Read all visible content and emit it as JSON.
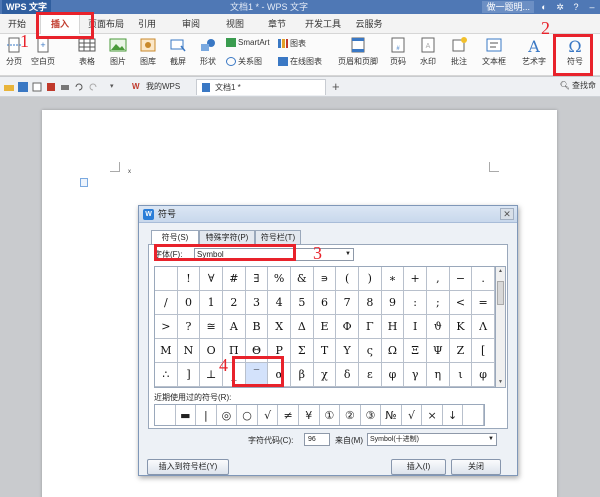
{
  "titlebar": {
    "app_name": "WPS 文字",
    "doc_title": "文档1 * - WPS 文字",
    "user_button": "做一题明...",
    "help_label": "?"
  },
  "ribbon_tabs": [
    "开始",
    "插入",
    "页面布局",
    "引用",
    "审阅",
    "视图",
    "章节",
    "开发工具",
    "云服务"
  ],
  "ribbon": {
    "buttons": [
      {
        "label": "分页",
        "icon": "page-break-icon"
      },
      {
        "label": "空白页",
        "icon": "blank-page-icon"
      },
      {
        "label": "表格",
        "icon": "table-icon"
      },
      {
        "label": "图片",
        "icon": "picture-icon"
      },
      {
        "label": "图库",
        "icon": "gallery-icon"
      },
      {
        "label": "截屏",
        "icon": "screenshot-icon"
      },
      {
        "label": "形状",
        "icon": "shapes-icon"
      },
      {
        "label": "页眉和页脚",
        "icon": "header-footer-icon"
      },
      {
        "label": "页码",
        "icon": "page-number-icon"
      },
      {
        "label": "水印",
        "icon": "watermark-icon"
      },
      {
        "label": "批注",
        "icon": "comment-icon"
      },
      {
        "label": "文本框",
        "icon": "textbox-icon"
      },
      {
        "label": "艺术字",
        "icon": "wordart-icon"
      },
      {
        "label": "符号",
        "icon": "omega-icon"
      }
    ],
    "smartart": "SmartArt",
    "chart": "图表",
    "relation": "关系图",
    "online_chart": "在线图表"
  },
  "quickbar": {
    "tab_wps": "我的WPS",
    "tab_doc": "文档1 *",
    "search": "查找命"
  },
  "dialog": {
    "title": "符号",
    "tabs": [
      "符号(S)",
      "特殊字符(P)",
      "符号栏(T)"
    ],
    "font_label": "字体(F):",
    "font_value": "Symbol",
    "symbols": [
      "",
      "!",
      "∀",
      "#",
      "∃",
      "%",
      "&",
      "∍",
      "(",
      ")",
      "∗",
      "+",
      ",",
      "−",
      ".",
      "/",
      "0",
      "1",
      "2",
      "3",
      "4",
      "5",
      "6",
      "7",
      "8",
      "9",
      ":",
      ";",
      "<",
      "=",
      ">",
      "?",
      "≅",
      "Α",
      "Β",
      "Χ",
      "Δ",
      "Ε",
      "Φ",
      "Γ",
      "Η",
      "Ι",
      "ϑ",
      "Κ",
      "Λ",
      "Μ",
      "Ν",
      "Ο",
      "Π",
      "Θ",
      "Ρ",
      "Σ",
      "Τ",
      "Υ",
      "ς",
      "Ω",
      "Ξ",
      "Ψ",
      "Ζ",
      "[",
      "∴",
      "]",
      "⊥",
      "_",
      "‾",
      "α",
      "β",
      "χ",
      "δ",
      "ε",
      "φ",
      "γ",
      "η",
      "ι",
      "φ"
    ],
    "recent_label": "近期使用过的符号(R):",
    "recent": [
      "",
      "▬",
      "|",
      "◎",
      "○",
      "√",
      "≠",
      "¥",
      "①",
      "②",
      "③",
      "№",
      "√",
      "×",
      "↓",
      ""
    ],
    "code_label": "字符代码(C):",
    "code_value": "96",
    "from_label": "来自(M)",
    "from_value": "Symbol(十进制)",
    "btn_toolbar": "插入到符号栏(Y)",
    "btn_insert": "插入(I)",
    "btn_close": "关闭"
  },
  "annotations": [
    "1",
    "2",
    "3",
    "4"
  ],
  "colors": {
    "accent_red": "#e8222b",
    "title_blue": "#4f78b5"
  }
}
